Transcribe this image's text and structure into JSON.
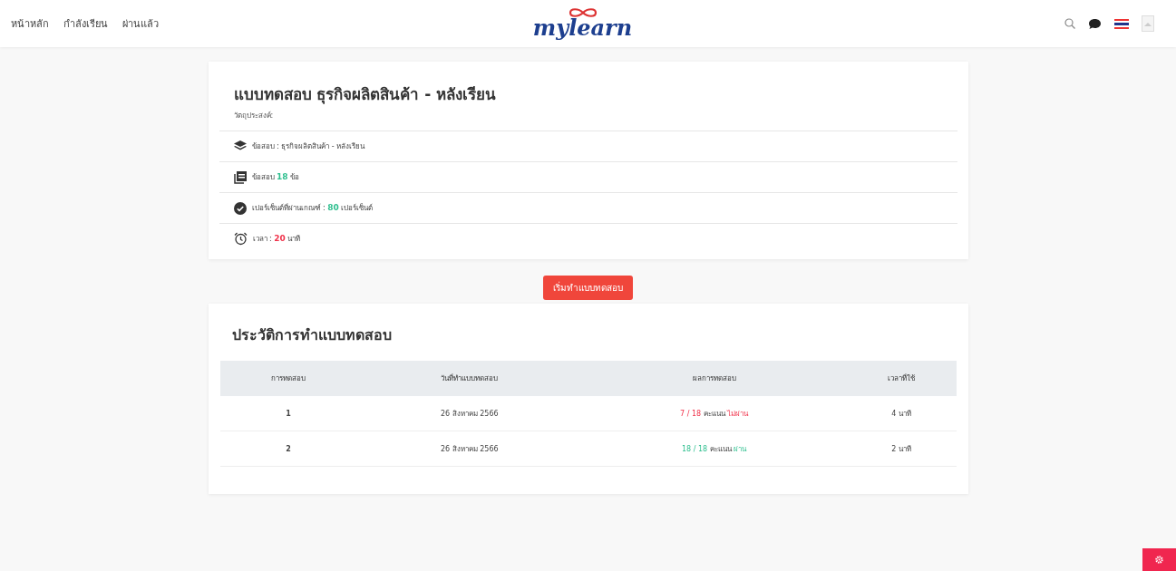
{
  "nav": {
    "links": [
      {
        "label": "หน้าหลัก"
      },
      {
        "label": "กำลังเรียน"
      },
      {
        "label": "ผ่านแล้ว"
      }
    ],
    "logo": "mylearn"
  },
  "quiz": {
    "title": "แบบทดสอบ ธุรกิจผลิตสินค้า - หลังเรียน",
    "objective": "วัตถุประสงค์:",
    "details": [
      {
        "kind": "layers",
        "prefix": "ข้อสอบ :  ธุรกิจผลิตสินค้า  -  หลังเรียน"
      },
      {
        "kind": "book",
        "prefix": "ข้อสอบ",
        "value": "18",
        "suffix": "ข้อ",
        "color": "#2fbf8f"
      },
      {
        "kind": "check",
        "prefix": "เปอร์เซ็นต์ที่ผ่านเกณฑ์ :",
        "value": "80",
        "suffix": "เปอร์เซ็นต์",
        "color": "#2fbf8f"
      },
      {
        "kind": "alarm",
        "prefix": "เวลา :",
        "value": "20",
        "suffix": "นาที",
        "color": "#f0334b"
      }
    ]
  },
  "start_button": "เริ่มทำแบบทดสอบ",
  "history": {
    "title": "ประวัติการทำแบบทดสอบ",
    "columns": [
      "การทดสอบ",
      "วันที่ทำแบบทดสอบ",
      "ผลการทดสอบ",
      "เวลาที่ใช้"
    ],
    "rows": [
      {
        "attempt": "1",
        "date": "26 สิงหาคม 2566",
        "score": "7 / 18",
        "unit": "คะแนน",
        "verdict": "ไม่ผ่าน",
        "passed": false,
        "time": "4 นาที"
      },
      {
        "attempt": "2",
        "date": "26 สิงหาคม 2566",
        "score": "18 / 18",
        "unit": "คะแนน",
        "verdict": "ผ่าน",
        "passed": true,
        "time": "2 นาที"
      }
    ]
  }
}
